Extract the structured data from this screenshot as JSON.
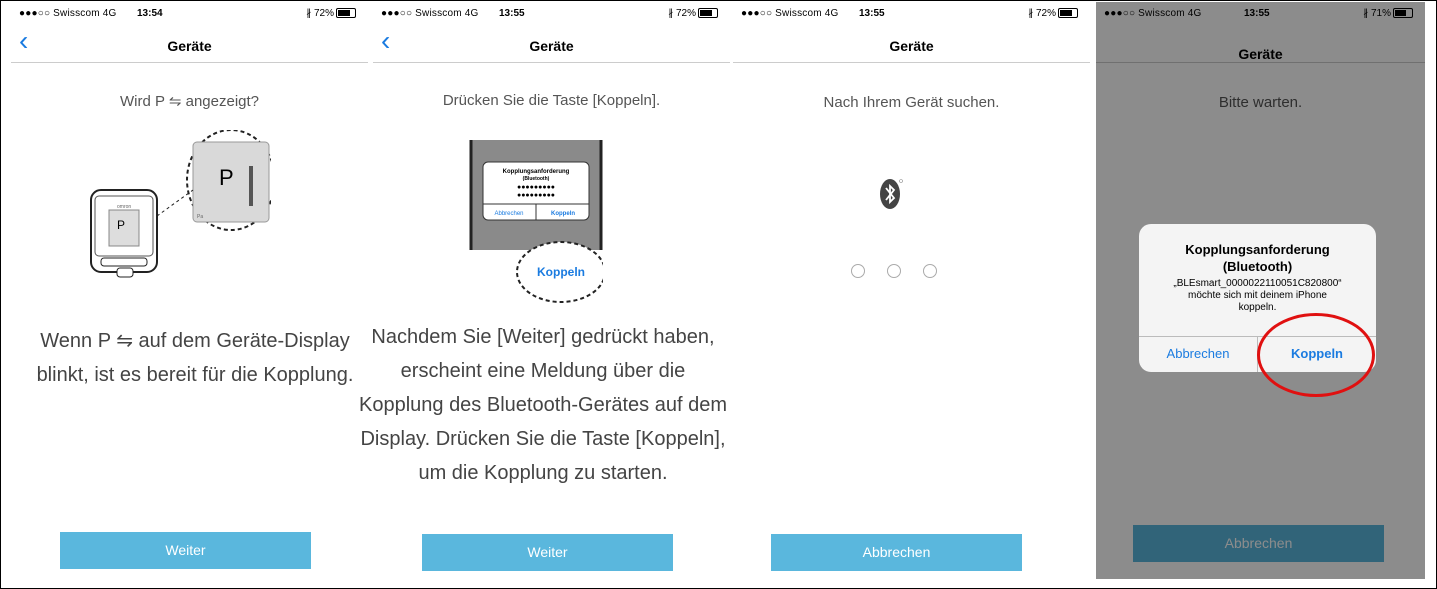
{
  "panels": [
    {
      "status": {
        "carrier": "●●●○○ Swisscom  4G",
        "time": "13:54",
        "battery": "∦ 72%",
        "battery_level": 0.72
      },
      "nav": {
        "back": "‹",
        "title": "Geräte"
      },
      "prompt": "Wird P ⇋ angezeigt?",
      "device_labels": {
        "screen_letter": "P",
        "zoom_letter": "P",
        "brand": "omron",
        "small": "Pa"
      },
      "description_lines": [
        "Wenn P ⇋ auf dem Geräte-Display",
        "blinkt, ist es bereit für die Kopplung."
      ],
      "button": "Weiter"
    },
    {
      "status": {
        "carrier": "●●●○○ Swisscom  4G",
        "time": "13:55",
        "battery": "∦ 72%",
        "battery_level": 0.72
      },
      "nav": {
        "back": "‹",
        "title": "Geräte"
      },
      "prompt": "Drücken Sie die Taste [Koppeln].",
      "mini_alert": {
        "title": "Kopplungsanforderung",
        "subtitle": "(Bluetooth)",
        "code": "●●●●●●●●●",
        "code2": "●●●●●●●●●",
        "cancel": "Abbrechen",
        "ok": "Koppeln",
        "callout": "Koppeln"
      },
      "description_lines": [
        "Nachdem Sie [Weiter] gedrückt haben,",
        "erscheint eine Meldung über die",
        "Kopplung des Bluetooth-Gerätes auf dem",
        "Display. Drücken Sie die Taste [Koppeln],",
        "um die Kopplung zu starten."
      ],
      "button": "Weiter"
    },
    {
      "status": {
        "carrier": "●●●○○ Swisscom  4G",
        "time": "13:55",
        "battery": "∦ 72%",
        "battery_level": 0.72
      },
      "nav": {
        "title": "Geräte"
      },
      "prompt": "Nach Ihrem Gerät suchen.",
      "button": "Abbrechen"
    },
    {
      "status": {
        "carrier": "●●●○○ Swisscom  4G",
        "time": "13:55",
        "battery": "∦ 71%",
        "battery_level": 0.71
      },
      "nav": {
        "title": "Geräte"
      },
      "prompt": "Bitte warten.",
      "alert": {
        "title": "Kopplungsanforderung",
        "subtitle": "(Bluetooth)",
        "body_lines": [
          "„BLEsmart_0000022110051C820800“",
          "möchte sich mit deinem iPhone",
          "koppeln."
        ],
        "cancel": "Abbrechen",
        "ok": "Koppeln"
      },
      "button": "Abbrechen"
    }
  ]
}
